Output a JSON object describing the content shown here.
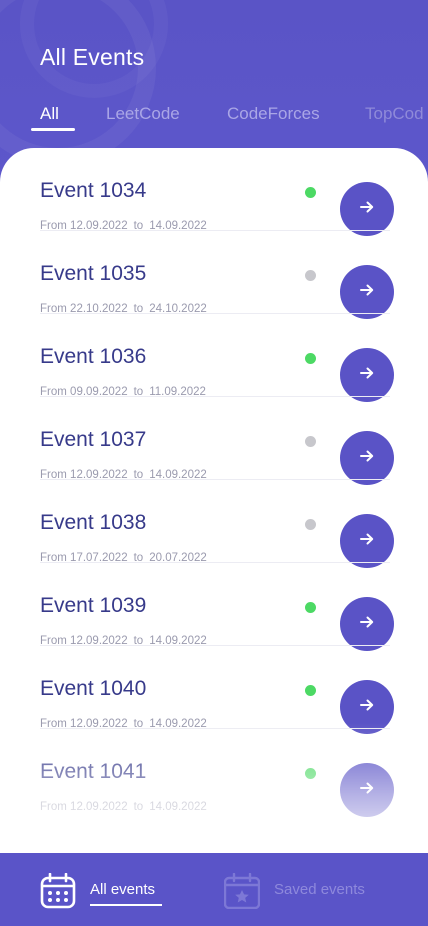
{
  "header": {
    "title": "All Events",
    "tabs": [
      {
        "label": "All",
        "active": true
      },
      {
        "label": "LeetCode",
        "active": false
      },
      {
        "label": "CodeForces",
        "active": false
      },
      {
        "label": "TopCod",
        "active": false
      }
    ]
  },
  "events": [
    {
      "title": "Event 1034",
      "from_label": "From",
      "from": "12.09.2022",
      "to_label": "to",
      "to": "14.09.2022",
      "status_color": "#4cd964"
    },
    {
      "title": "Event 1035",
      "from_label": "From",
      "from": "22.10.2022",
      "to_label": "to",
      "to": "24.10.2022",
      "status_color": "#c7c7cc"
    },
    {
      "title": "Event 1036",
      "from_label": "From",
      "from": "09.09.2022",
      "to_label": "to",
      "to": "11.09.2022",
      "status_color": "#4cd964"
    },
    {
      "title": "Event 1037",
      "from_label": "From",
      "from": "12.09.2022",
      "to_label": "to",
      "to": "14.09.2022",
      "status_color": "#c7c7cc"
    },
    {
      "title": "Event 1038",
      "from_label": "From",
      "from": "17.07.2022",
      "to_label": "to",
      "to": "20.07.2022",
      "status_color": "#c7c7cc"
    },
    {
      "title": "Event 1039",
      "from_label": "From",
      "from": "12.09.2022",
      "to_label": "to",
      "to": "14.09.2022",
      "status_color": "#4cd964"
    },
    {
      "title": "Event 1040",
      "from_label": "From",
      "from": "12.09.2022",
      "to_label": "to",
      "to": "14.09.2022",
      "status_color": "#4cd964"
    },
    {
      "title": "Event 1041",
      "from_label": "From",
      "from": "12.09.2022",
      "to_label": "to",
      "to": "14.09.2022",
      "status_color": "#4cd964"
    }
  ],
  "bottom_nav": {
    "items": [
      {
        "label": "All events",
        "icon": "calendar-grid-icon",
        "active": true
      },
      {
        "label": "Saved events",
        "icon": "calendar-star-icon",
        "active": false
      }
    ]
  },
  "colors": {
    "brand": "#5a54c8",
    "active_status": "#4cd964",
    "inactive_status": "#c7c7cc",
    "title_text": "#373a8a"
  }
}
